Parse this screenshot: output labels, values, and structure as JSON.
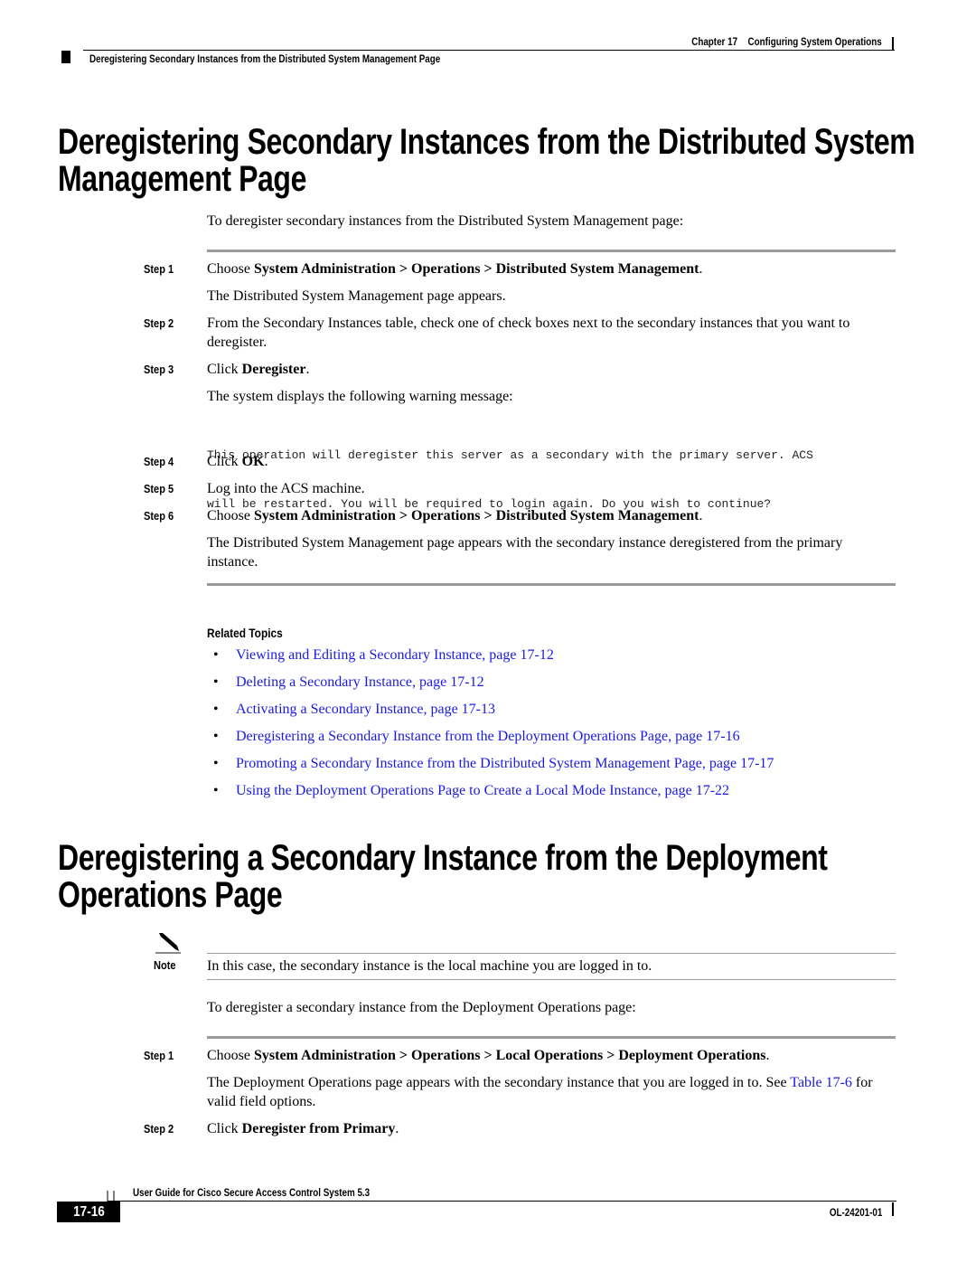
{
  "header": {
    "chapter": "Chapter 17",
    "chapter_title": "Configuring System Operations",
    "section": "Deregistering Secondary Instances from the Distributed System Management Page"
  },
  "section1": {
    "title_line1": "Deregistering Secondary Instances from the Distributed System",
    "title_line2": "Management Page",
    "intro": "To deregister secondary instances from the Distributed System Management page:",
    "steps": [
      {
        "label": "Step 1",
        "pre": "Choose ",
        "bold": "System Administration > Operations > Distributed System Management",
        "post": ".",
        "result": "The Distributed System Management page appears."
      },
      {
        "label": "Step 2",
        "text": "From the Secondary Instances table, check one of check boxes next to the secondary instances that you want to deregister."
      },
      {
        "label": "Step 3",
        "pre": "Click ",
        "bold": "Deregister",
        "post": ".",
        "result": "The system displays the following warning message:",
        "code_line1": "This operation will deregister this server as a secondary with the primary server. ACS",
        "code_line2": "will be restarted. You will be required to login again. Do you wish to continue?"
      },
      {
        "label": "Step 4",
        "pre": "Click ",
        "bold": "OK",
        "post": "."
      },
      {
        "label": "Step 5",
        "text": "Log into the ACS machine."
      },
      {
        "label": "Step 6",
        "pre": "Choose ",
        "bold": "System Administration > Operations > Distributed System Management",
        "post": ".",
        "result": "The Distributed System Management page appears with the secondary instance deregistered from the primary instance."
      }
    ],
    "related_title": "Related Topics",
    "related": [
      "Viewing and Editing a Secondary Instance, page 17-12",
      "Deleting a Secondary Instance, page 17-12",
      "Activating a Secondary Instance, page 17-13",
      "Deregistering a Secondary Instance from the Deployment Operations Page, page 17-16",
      "Promoting a Secondary Instance from the Distributed System Management Page, page 17-17",
      "Using the Deployment Operations Page to Create a Local Mode Instance, page 17-22"
    ]
  },
  "section2": {
    "title_line1": "Deregistering a Secondary Instance from the Deployment",
    "title_line2": "Operations Page",
    "note_label": "Note",
    "note_text": "In this case, the secondary instance is the local machine you are logged in to.",
    "intro": "To deregister a secondary instance from the Deployment Operations page:",
    "steps": [
      {
        "label": "Step 1",
        "pre": "Choose ",
        "bold": "System Administration > Operations > Local Operations > Deployment Operations",
        "post": ".",
        "result_pre": "The Deployment Operations page appears with the secondary instance that you are logged in to. See ",
        "result_link": "Table 17-6",
        "result_post": " for valid field options."
      },
      {
        "label": "Step 2",
        "pre": "Click ",
        "bold": "Deregister from Primary",
        "post": "."
      }
    ]
  },
  "footer": {
    "guide_title": "User Guide for Cisco Secure Access Control System 5.3",
    "page_number": "17-16",
    "doc_number": "OL-24201-01"
  },
  "colors": {
    "link": "#1a1ae6",
    "rule": "#9a9a9a"
  }
}
